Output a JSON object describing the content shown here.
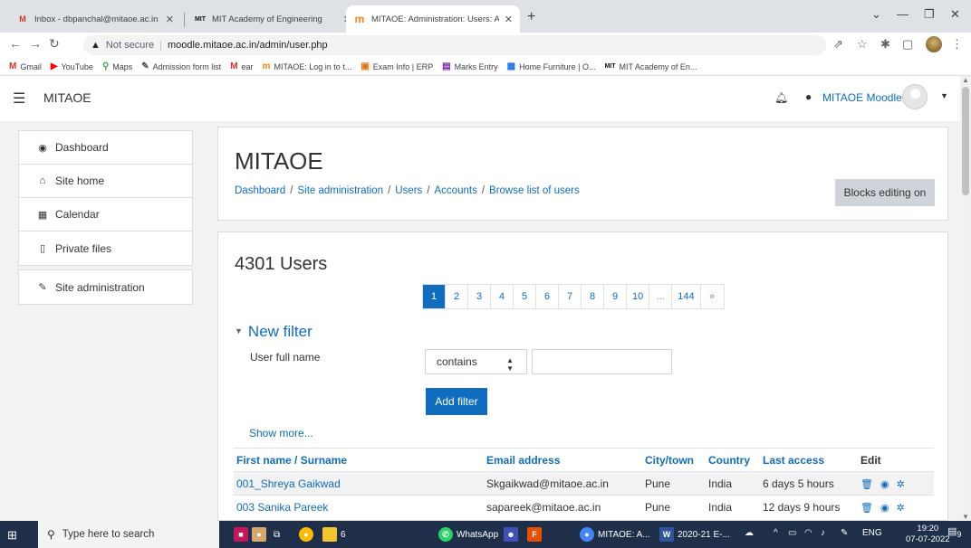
{
  "browser": {
    "tabs": [
      {
        "icon": "M",
        "title": "Inbox - dbpanchal@mitaoe.ac.in"
      },
      {
        "icon": "MIT",
        "title": "MIT Academy of Engineering"
      },
      {
        "icon": "m",
        "title": "MITAOE: Administration: Users: A"
      }
    ],
    "close_glyph": "✕",
    "new_tab": "+",
    "address": {
      "security": "Not secure",
      "url": "moodle.mitaoe.ac.in/admin/user.php"
    },
    "bookmarks": [
      {
        "icon": "M",
        "label": "Gmail"
      },
      {
        "icon": "▶",
        "label": "YouTube"
      },
      {
        "icon": "⚲",
        "label": "Maps"
      },
      {
        "icon": "✎",
        "label": "Admission form list"
      },
      {
        "icon": "M",
        "label": "ear"
      },
      {
        "icon": "m",
        "label": "MITAOE: Log in to t..."
      },
      {
        "icon": "▣",
        "label": "Exam Info | ERP"
      },
      {
        "icon": "▤",
        "label": "Marks Entry"
      },
      {
        "icon": "▦",
        "label": "Home Furniture | O..."
      },
      {
        "icon": "MIT",
        "label": "MIT Academy of En..."
      }
    ]
  },
  "moodle": {
    "brand": "MITAOE",
    "user_name": "MITAOE Moodle",
    "nav": [
      "Dashboard",
      "Site home",
      "Calendar",
      "Private files"
    ],
    "nav_admin": "Site administration",
    "page_title": "MITAOE",
    "breadcrumb": [
      "Dashboard",
      "Site administration",
      "Users",
      "Accounts",
      "Browse list of users"
    ],
    "blocks_button": "Blocks editing on",
    "user_count": "4301 Users",
    "pages": [
      "1",
      "2",
      "3",
      "4",
      "5",
      "6",
      "7",
      "8",
      "9",
      "10",
      "...",
      "144",
      "»"
    ],
    "filter": {
      "legend": "New filter",
      "label": "User full name",
      "operator": "contains",
      "value": "",
      "add_button": "Add filter",
      "show_more": "Show more..."
    },
    "table": {
      "headers": [
        "First name / Surname",
        "Email address",
        "City/town",
        "Country",
        "Last access",
        "Edit"
      ],
      "rows": [
        {
          "name": "001_Shreya Gaikwad",
          "email": "Skgaikwad@mitaoe.ac.in",
          "city": "Pune",
          "country": "India",
          "last": "6 days 5 hours"
        },
        {
          "name": "003 Sanika Pareek",
          "email": "sapareek@mitaoe.ac.in",
          "city": "Pune",
          "country": "India",
          "last": "12 days 9 hours"
        }
      ]
    }
  },
  "taskbar": {
    "search": "Type here to search",
    "badge": "6",
    "apps": [
      "WhatsApp",
      "MITAOE: A...",
      "2020-21 E-..."
    ],
    "lang": "ENG",
    "time": "19:20",
    "date": "07-07-2022",
    "notifications": "9"
  }
}
